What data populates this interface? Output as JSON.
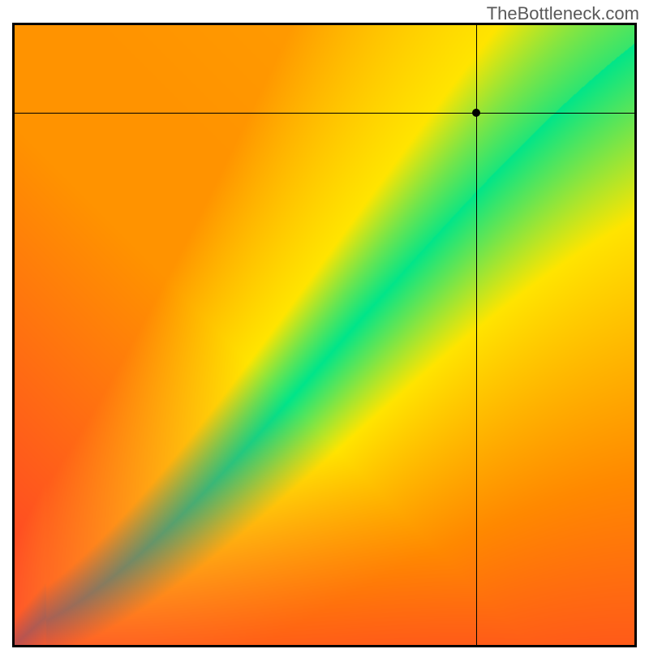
{
  "watermark": "TheBottleneck.com",
  "chart_data": {
    "type": "heatmap",
    "title": "",
    "xlabel": "",
    "ylabel": "",
    "xlim": [
      0,
      1
    ],
    "ylim": [
      0,
      1
    ],
    "crosshair": {
      "x": 0.745,
      "y": 0.858
    },
    "marker": {
      "x": 0.745,
      "y": 0.858
    },
    "balanced_curve_description": "Green ridge of balanced performance running roughly diagonally; below-left is CPU-bound (red), above-right is GPU-bound (yellow/orange).",
    "palette": {
      "bottleneck_high": "#ff1f3a",
      "bottleneck_mid": "#ff8a00",
      "near_balance": "#ffe500",
      "balanced": "#00e58a",
      "secondary_mid": "#ffb400"
    }
  }
}
